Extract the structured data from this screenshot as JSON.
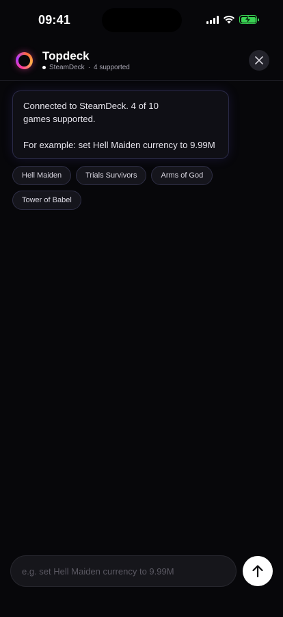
{
  "status_bar": {
    "time": "09:41",
    "battery_color": "#39d353"
  },
  "header": {
    "title": "Topdeck",
    "device": "SteamDeck",
    "separator": "·",
    "supported": "4 supported",
    "logo_icon": "ring-logo-icon",
    "close_icon": "close-icon"
  },
  "message": {
    "line1": "Connected to SteamDeck. 4 of 10",
    "line2": "games supported.",
    "example": "For example: set Hell Maiden currency to 9.99M"
  },
  "chips": [
    {
      "label": "Hell Maiden"
    },
    {
      "label": "Trials Survivors"
    },
    {
      "label": "Arms of God"
    },
    {
      "label": "Tower of Babel"
    }
  ],
  "composer": {
    "placeholder": "e.g. set Hell Maiden currency to 9.99M",
    "value": "",
    "send_icon": "arrow-up-icon"
  },
  "theme": {
    "background": "#07070a",
    "accent_gradient": [
      "#ff3d9a",
      "#b23bff",
      "#ffb04a"
    ]
  }
}
